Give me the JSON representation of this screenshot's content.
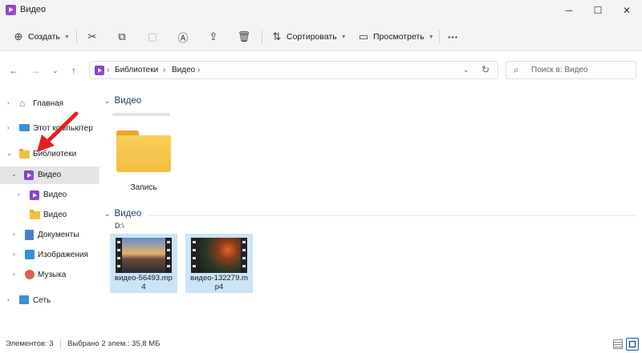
{
  "window": {
    "title": "Видео"
  },
  "toolbar": {
    "create_label": "Создать",
    "sort_label": "Сортировать",
    "view_label": "Просмотреть",
    "more_label": "···"
  },
  "address": {
    "crumbs": [
      "Библиотеки",
      "Видео"
    ],
    "search_placeholder": "Поиск в: Видео"
  },
  "sidebar": {
    "items": [
      {
        "label": "Главная"
      },
      {
        "label": "Этот компьютер"
      },
      {
        "label": "Библиотеки"
      },
      {
        "label": "Видео"
      },
      {
        "label": "Видео"
      },
      {
        "label": "Видео"
      },
      {
        "label": "Документы"
      },
      {
        "label": "Изображения"
      },
      {
        "label": "Музыка"
      },
      {
        "label": "Сеть"
      }
    ]
  },
  "content": {
    "groups": [
      {
        "title": "Видео",
        "subtitle": ""
      },
      {
        "title": "Видео",
        "subtitle": "D:\\"
      }
    ],
    "folder": {
      "name": "Запись"
    },
    "files": [
      {
        "name_line1": "видео-56493.mp",
        "name_line2": "4"
      },
      {
        "name_line1": "видео-132279.m",
        "name_line2": "p4"
      }
    ]
  },
  "status": {
    "items_count": "Элементов: 3",
    "selected": "Выбрано 2 элем.: 35,8 МБ"
  },
  "colors": {
    "accent": "#0067c0",
    "selection": "#cce4f7",
    "arrow": "#e02020"
  }
}
